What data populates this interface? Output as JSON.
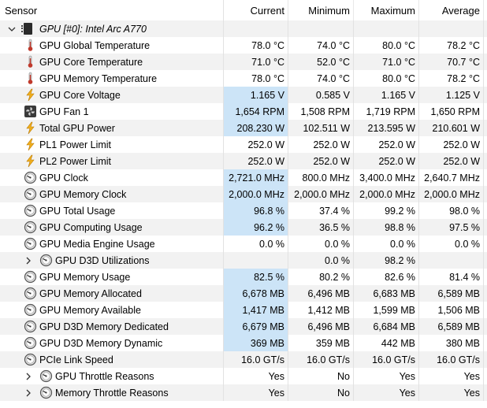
{
  "header": {
    "sensor": "Sensor",
    "current": "Current",
    "minimum": "Minimum",
    "maximum": "Maximum",
    "average": "Average"
  },
  "group": {
    "label": "GPU [#0]: Intel Arc A770",
    "chip_icon": "gpu-chip-icon",
    "expander_icon": "chevron-down-icon"
  },
  "colors": {
    "highlight": "#cce4f7",
    "alt_row": "#f2f2f2",
    "thermometer": "#c0392b",
    "lightning": "#f2b01e"
  },
  "rows": [
    {
      "name": "GPU Global Temperature",
      "icon": "thermometer-icon",
      "current": "78.0 °C",
      "min": "74.0 °C",
      "max": "80.0 °C",
      "avg": "78.2 °C",
      "hl": false
    },
    {
      "name": "GPU Core Temperature",
      "icon": "thermometer-icon",
      "current": "71.0 °C",
      "min": "52.0 °C",
      "max": "71.0 °C",
      "avg": "70.7 °C",
      "hl": false
    },
    {
      "name": "GPU Memory Temperature",
      "icon": "thermometer-icon",
      "current": "78.0 °C",
      "min": "74.0 °C",
      "max": "80.0 °C",
      "avg": "78.2 °C",
      "hl": false
    },
    {
      "name": "GPU Core Voltage",
      "icon": "lightning-icon",
      "current": "1.165 V",
      "min": "0.585 V",
      "max": "1.165 V",
      "avg": "1.125 V",
      "hl": true
    },
    {
      "name": "GPU Fan 1",
      "icon": "fan-icon",
      "current": "1,654 RPM",
      "min": "1,508 RPM",
      "max": "1,719 RPM",
      "avg": "1,650 RPM",
      "hl": true
    },
    {
      "name": "Total GPU Power",
      "icon": "lightning-icon",
      "current": "208.230 W",
      "min": "102.511 W",
      "max": "213.595 W",
      "avg": "210.601 W",
      "hl": true
    },
    {
      "name": "PL1 Power Limit",
      "icon": "lightning-icon",
      "current": "252.0 W",
      "min": "252.0 W",
      "max": "252.0 W",
      "avg": "252.0 W",
      "hl": false
    },
    {
      "name": "PL2 Power Limit",
      "icon": "lightning-icon",
      "current": "252.0 W",
      "min": "252.0 W",
      "max": "252.0 W",
      "avg": "252.0 W",
      "hl": false
    },
    {
      "name": "GPU Clock",
      "icon": "gauge-icon",
      "current": "2,721.0 MHz",
      "min": "800.0 MHz",
      "max": "3,400.0 MHz",
      "avg": "2,640.7 MHz",
      "hl": true
    },
    {
      "name": "GPU Memory Clock",
      "icon": "gauge-icon",
      "current": "2,000.0 MHz",
      "min": "2,000.0 MHz",
      "max": "2,000.0 MHz",
      "avg": "2,000.0 MHz",
      "hl": true
    },
    {
      "name": "GPU Total Usage",
      "icon": "gauge-icon",
      "current": "96.8 %",
      "min": "37.4 %",
      "max": "99.2 %",
      "avg": "98.0 %",
      "hl": true
    },
    {
      "name": "GPU Computing Usage",
      "icon": "gauge-icon",
      "current": "96.2 %",
      "min": "36.5 %",
      "max": "98.8 %",
      "avg": "97.5 %",
      "hl": true
    },
    {
      "name": "GPU Media Engine Usage",
      "icon": "gauge-icon",
      "current": "0.0 %",
      "min": "0.0 %",
      "max": "0.0 %",
      "avg": "0.0 %",
      "hl": false
    },
    {
      "name": "GPU D3D Utilizations",
      "icon": "gauge-icon",
      "expandable": true,
      "current": "",
      "min": "0.0 %",
      "max": "98.2 %",
      "avg": "",
      "hl": false
    },
    {
      "name": "GPU Memory Usage",
      "icon": "gauge-icon",
      "current": "82.5 %",
      "min": "80.2 %",
      "max": "82.6 %",
      "avg": "81.4 %",
      "hl": true
    },
    {
      "name": "GPU Memory Allocated",
      "icon": "gauge-icon",
      "current": "6,678 MB",
      "min": "6,496 MB",
      "max": "6,683 MB",
      "avg": "6,589 MB",
      "hl": true
    },
    {
      "name": "GPU Memory Available",
      "icon": "gauge-icon",
      "current": "1,417 MB",
      "min": "1,412 MB",
      "max": "1,599 MB",
      "avg": "1,506 MB",
      "hl": true
    },
    {
      "name": "GPU D3D Memory Dedicated",
      "icon": "gauge-icon",
      "current": "6,679 MB",
      "min": "6,496 MB",
      "max": "6,684 MB",
      "avg": "6,589 MB",
      "hl": true
    },
    {
      "name": "GPU D3D Memory Dynamic",
      "icon": "gauge-icon",
      "current": "369 MB",
      "min": "359 MB",
      "max": "442 MB",
      "avg": "380 MB",
      "hl": true
    },
    {
      "name": "PCIe Link Speed",
      "icon": "gauge-icon",
      "current": "16.0 GT/s",
      "min": "16.0 GT/s",
      "max": "16.0 GT/s",
      "avg": "16.0 GT/s",
      "hl": false
    },
    {
      "name": "GPU Throttle Reasons",
      "icon": "gauge-icon",
      "expandable": true,
      "current": "Yes",
      "min": "No",
      "max": "Yes",
      "avg": "Yes",
      "hl": false
    },
    {
      "name": "Memory Throttle Reasons",
      "icon": "gauge-icon",
      "expandable": true,
      "current": "Yes",
      "min": "No",
      "max": "Yes",
      "avg": "Yes",
      "hl": false
    }
  ]
}
